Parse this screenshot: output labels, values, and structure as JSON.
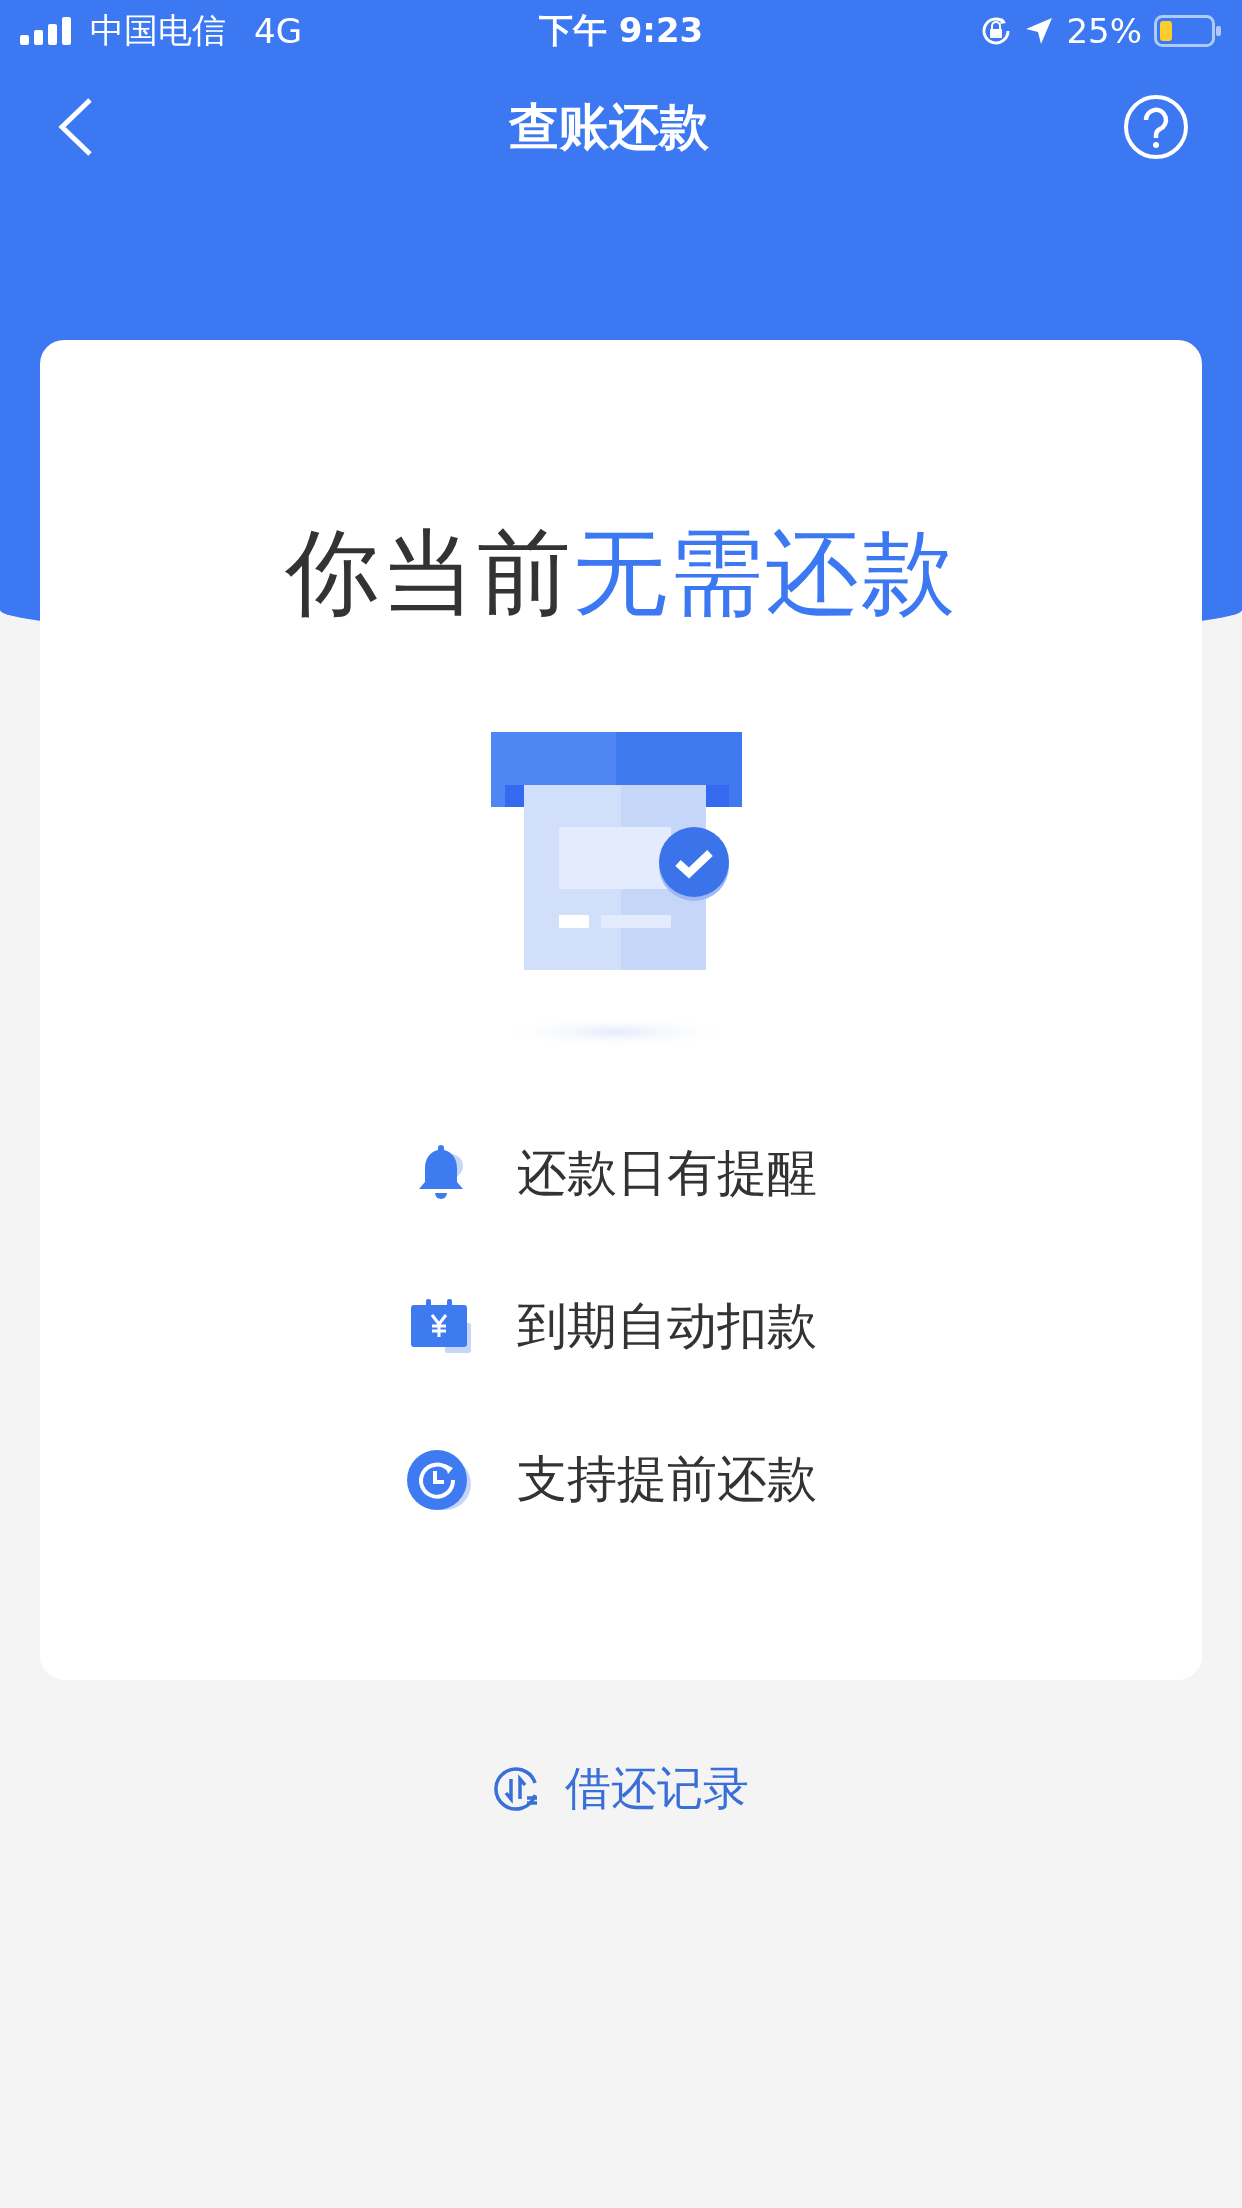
{
  "status_bar": {
    "carrier": "中国电信",
    "network": "4G",
    "time": "下午 9:23",
    "battery": "25%"
  },
  "nav": {
    "title": "查账还款"
  },
  "card": {
    "headline": {
      "prefix": "你当前",
      "highlight": "无需还款"
    },
    "features": [
      {
        "kind": "bell",
        "label": "还款日有提醒"
      },
      {
        "kind": "calendar",
        "label": "到期自动扣款"
      },
      {
        "kind": "clock",
        "label": "支持提前还款"
      }
    ]
  },
  "record_link": {
    "label": "借还记录"
  }
}
